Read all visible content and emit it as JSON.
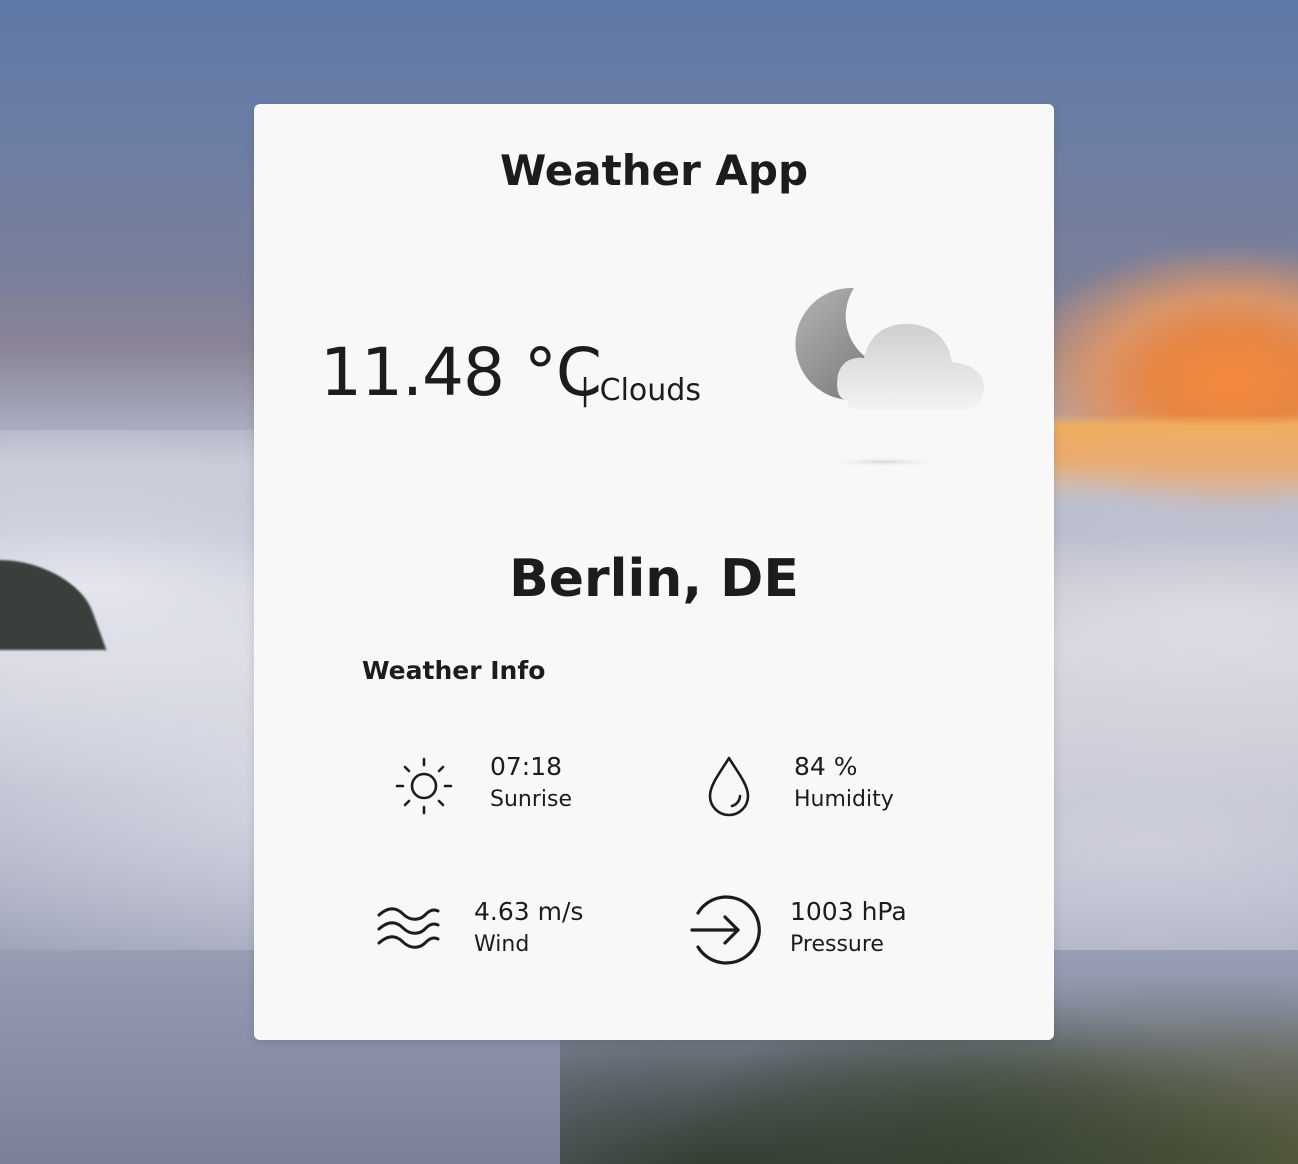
{
  "app": {
    "title": "Weather App"
  },
  "current": {
    "temperature": "11.48 °C",
    "condition": "| Clouds",
    "icon": "moon-cloud-icon"
  },
  "location": {
    "city": "Berlin, DE"
  },
  "weather_info": {
    "heading": "Weather Info",
    "items": [
      {
        "icon": "sun-icon",
        "value": "07:18",
        "label": "Sunrise"
      },
      {
        "icon": "water-drop-icon",
        "value": "84 %",
        "label": "Humidity"
      },
      {
        "icon": "wind-icon",
        "value": "4.63 m/s",
        "label": "Wind"
      },
      {
        "icon": "arrow-circle-right-icon",
        "value": "1003 hPa",
        "label": "Pressure"
      }
    ]
  },
  "colors": {
    "card_background": "#f8f8f8",
    "text": "#1c1c1c"
  }
}
